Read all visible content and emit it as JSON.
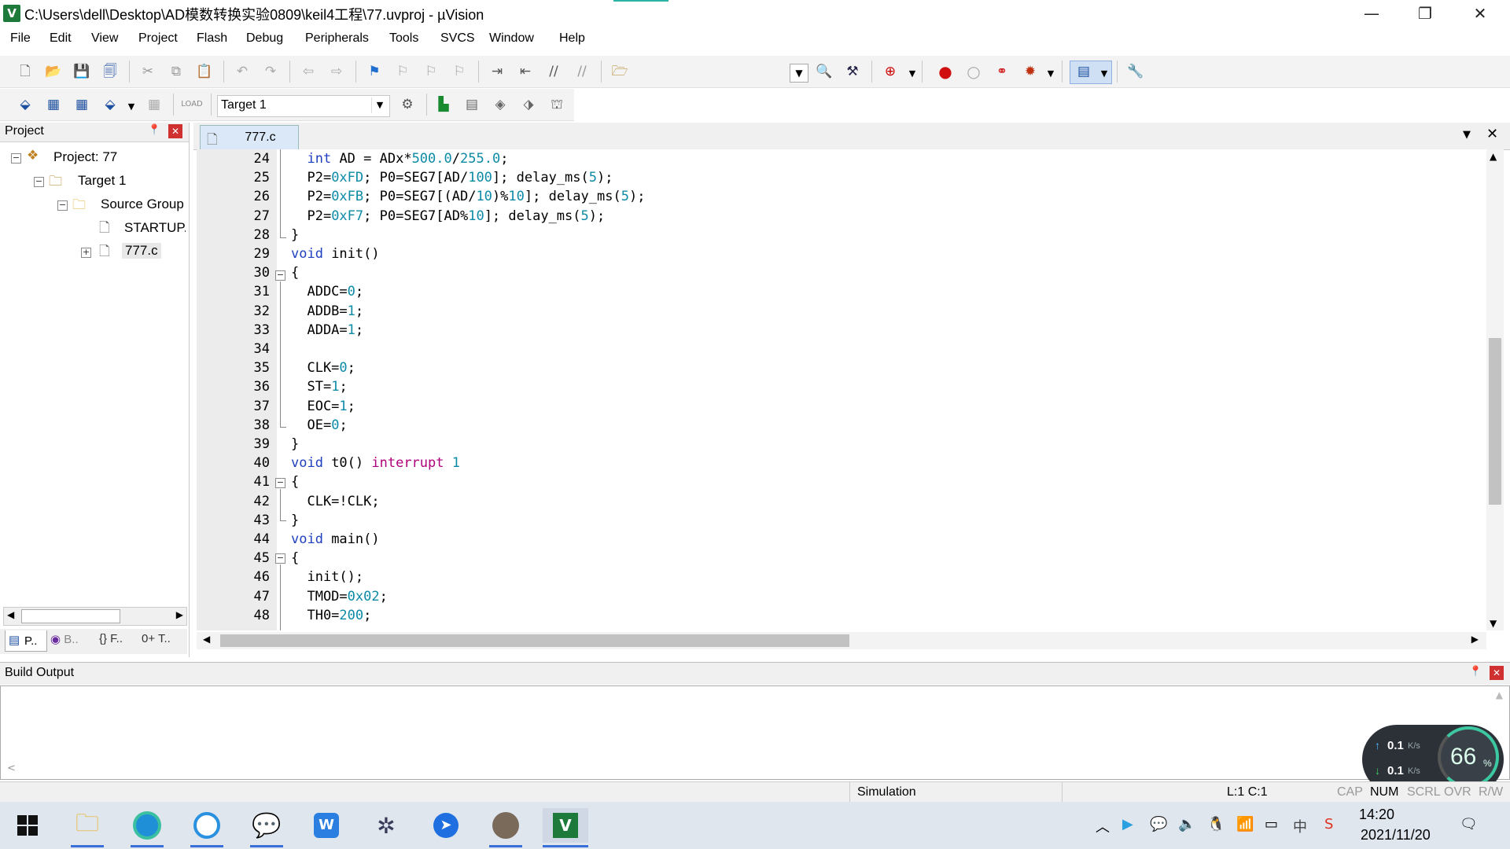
{
  "window": {
    "title": "C:\\Users\\dell\\Desktop\\AD模数转换实验0809\\keil4工程\\77.uvproj - µVision",
    "app_icon": "V",
    "minimize_icon": "—",
    "restore_icon": "❐",
    "close_icon": "✕"
  },
  "menu": [
    "File",
    "Edit",
    "View",
    "Project",
    "Flash",
    "Debug",
    "Peripherals",
    "Tools",
    "SVCS",
    "Window",
    "Help"
  ],
  "toolbar2": {
    "target": "Target 1"
  },
  "project_pane": {
    "title": "Project",
    "pin_icon": "📌",
    "close_icon": "✕",
    "tree": {
      "project": "Project: 77",
      "target": "Target 1",
      "group": "Source Group",
      "file1": "STARTUP.A",
      "file2": "777.c"
    },
    "tabs": [
      "P..",
      "B..",
      "{} F..",
      "0+ T.."
    ]
  },
  "editor": {
    "tab": "777.c",
    "lines": [
      {
        "n": "24",
        "html": "  <span class='kw'>int</span> AD = ADx*<span class='num'>500.0</span>/<span class='num'>255.0</span>;"
      },
      {
        "n": "25",
        "html": "  P2=<span class='num'>0xFD</span>; P0=SEG7[AD/<span class='num'>100</span>]; delay_ms(<span class='num'>5</span>);"
      },
      {
        "n": "26",
        "html": "  P2=<span class='num'>0xFB</span>; P0=SEG7[(AD/<span class='num'>10</span>)%<span class='num'>10</span>]; delay_ms(<span class='num'>5</span>);"
      },
      {
        "n": "27",
        "html": "  P2=<span class='num'>0xF7</span>; P0=SEG7[AD%<span class='num'>10</span>]; delay_ms(<span class='num'>5</span>);"
      },
      {
        "n": "28",
        "html": "}"
      },
      {
        "n": "29",
        "html": "<span class='kw'>void</span> init()"
      },
      {
        "n": "30",
        "html": "{"
      },
      {
        "n": "31",
        "html": "  ADDC=<span class='num'>0</span>;"
      },
      {
        "n": "32",
        "html": "  ADDB=<span class='num'>1</span>;"
      },
      {
        "n": "33",
        "html": "  ADDA=<span class='num'>1</span>;"
      },
      {
        "n": "34",
        "html": ""
      },
      {
        "n": "35",
        "html": "  CLK=<span class='num'>0</span>;"
      },
      {
        "n": "36",
        "html": "  ST=<span class='num'>1</span>;"
      },
      {
        "n": "37",
        "html": "  EOC=<span class='num'>1</span>;"
      },
      {
        "n": "38",
        "html": "  OE=<span class='num'>0</span>;"
      },
      {
        "n": "39",
        "html": "}"
      },
      {
        "n": "40",
        "html": "<span class='kw'>void</span> t0() <span class='kw2'>interrupt</span> <span class='num'>1</span>"
      },
      {
        "n": "41",
        "html": "{"
      },
      {
        "n": "42",
        "html": "  CLK=!CLK;"
      },
      {
        "n": "43",
        "html": "}"
      },
      {
        "n": "44",
        "html": "<span class='kw'>void</span> main()"
      },
      {
        "n": "45",
        "html": "{"
      },
      {
        "n": "46",
        "html": "  init();"
      },
      {
        "n": "47",
        "html": "  TMOD=<span class='num'>0x02</span>;"
      },
      {
        "n": "48",
        "html": "  TH0=<span class='num'>200</span>;"
      }
    ]
  },
  "build_output": {
    "title": "Build Output"
  },
  "statusbar": {
    "mode": "Simulation",
    "position": "L:1 C:1",
    "indicators": [
      "CAP",
      "NUM",
      "SCRL",
      "OVR",
      "R/W"
    ]
  },
  "netmeter": {
    "up": "0.1",
    "down": "0.1",
    "unit": "K/s",
    "percent": "66",
    "percent_sign": "%"
  },
  "taskbar": {
    "time": "14:20",
    "date": "2021/11/20"
  }
}
